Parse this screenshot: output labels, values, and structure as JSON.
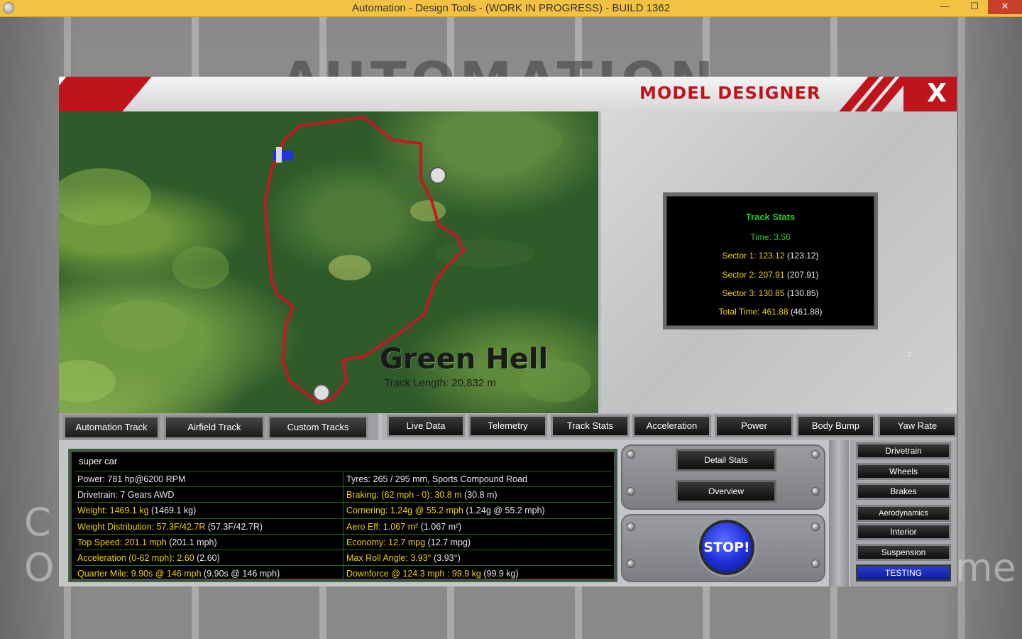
{
  "window": {
    "title": "Automation - Design Tools - (WORK IN PROGRESS) - BUILD 1362",
    "minimize": "—",
    "maximize": "☐",
    "close": "✕"
  },
  "background": {
    "logo_text": "AUTOMATION",
    "left_text_1": "C",
    "left_text_2": "O",
    "right_text": "me"
  },
  "header": {
    "title": "MODEL DESIGNER",
    "close_label": "X",
    "accent_color": "#c0141c"
  },
  "map": {
    "track_name": "Green Hell",
    "track_length": "Track Length: 20,832 m"
  },
  "track_stats": {
    "title": "Track Stats",
    "time": "Time: 3.56",
    "sectors": [
      {
        "label": "Sector 1: 123.12",
        "paren": " (123.12)"
      },
      {
        "label": "Sector 2: 207.91",
        "paren": " (207.91)"
      },
      {
        "label": "Sector 3: 130.85",
        "paren": " (130.85)"
      },
      {
        "label": "Total Time: 461.88",
        "paren": " (461.88)"
      }
    ],
    "page_number": "2"
  },
  "track_tabs": [
    "Automation Track",
    "Airfield Track",
    "Custom Tracks"
  ],
  "stat_tabs": [
    "Live Data",
    "Telemetry",
    "Track Stats",
    "Acceleration",
    "Power",
    "Body Bump",
    "Yaw Rate"
  ],
  "info": {
    "title": "super car",
    "rows": [
      {
        "l": "Power: 781 hp@6200 RPM",
        "lp": "",
        "r": "Tyres: 265 / 295 mm, Sports Compound Road",
        "rp": "",
        "lc": "w",
        "rc": "w"
      },
      {
        "l": "Drivetrain: 7 Gears AWD",
        "lp": "",
        "r": "Braking: (62 mph - 0): 30.8 m",
        "rp": " (30.8 m)",
        "lc": "w",
        "rc": "y"
      },
      {
        "l": "Weight: 1469.1 kg",
        "lp": " (1469.1 kg)",
        "r": "Cornering: 1.24g @ 55.2 mph",
        "rp": " (1.24g @ 55.2 mph)",
        "lc": "y",
        "rc": "y"
      },
      {
        "l": "Weight Distribution: 57.3F/42.7R",
        "lp": " (57.3F/42.7R)",
        "r": "Aero Eff: 1.067 m²",
        "rp": " (1.067 m²)",
        "lc": "y",
        "rc": "y"
      },
      {
        "l": "Top Speed: 201.1 mph",
        "lp": " (201.1 mph)",
        "r": "Economy: 12.7 mpg",
        "rp": " (12.7 mpg)",
        "lc": "y",
        "rc": "y"
      },
      {
        "l": "Acceleration (0-62 mph): 2.60",
        "lp": " (2.60)",
        "r": "Max Roll Angle: 3.93°",
        "rp": " (3.93°)",
        "lc": "y",
        "rc": "y"
      },
      {
        "l": "Quarter Mile: 9.90s @ 146 mph",
        "lp": " (9.90s @ 146 mph)",
        "r": "Downforce @ 124.3 mph : 99.9 kg",
        "rp": " (99.9 kg)",
        "lc": "y",
        "rc": "y"
      }
    ]
  },
  "controls": {
    "detail_stats": "Detail Stats",
    "overview": "Overview",
    "stop": "STOP!"
  },
  "side_menu": [
    "Drivetrain",
    "Wheels",
    "Brakes",
    "Aerodynamics",
    "Interior",
    "Suspension",
    "TESTING"
  ],
  "side_menu_active": "TESTING"
}
